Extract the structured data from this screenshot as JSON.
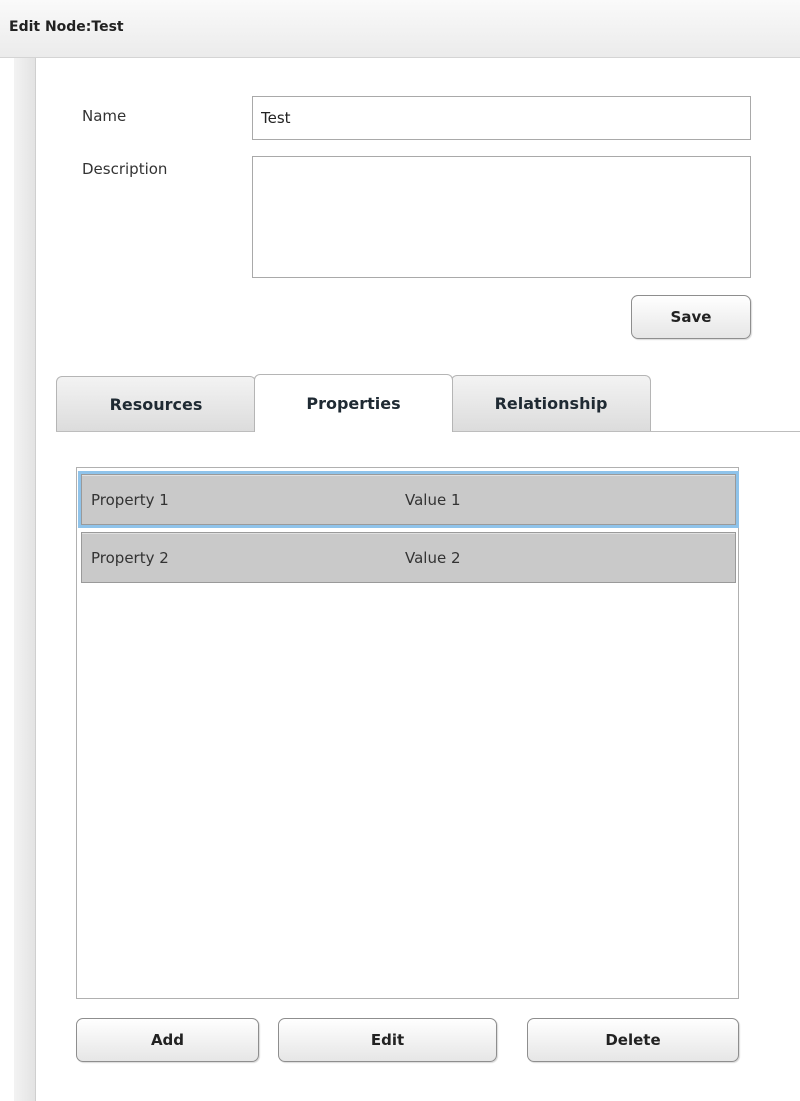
{
  "window": {
    "title": "Edit Node:Test"
  },
  "form": {
    "name_label": "Name",
    "name_value": "Test",
    "description_label": "Description",
    "description_value": "",
    "save_label": "Save"
  },
  "tabs": [
    {
      "label": "Resources",
      "active": false
    },
    {
      "label": "Properties",
      "active": true
    },
    {
      "label": "Relationship",
      "active": false
    }
  ],
  "properties": {
    "rows": [
      {
        "name": "Property 1",
        "value": "Value 1",
        "selected": true
      },
      {
        "name": "Property 2",
        "value": "Value 2",
        "selected": false
      }
    ]
  },
  "actions": {
    "add_label": "Add",
    "edit_label": "Edit",
    "delete_label": "Delete"
  },
  "colors": {
    "selection_outline": "#8fc3ea",
    "row_background": "#c9c9c9"
  }
}
